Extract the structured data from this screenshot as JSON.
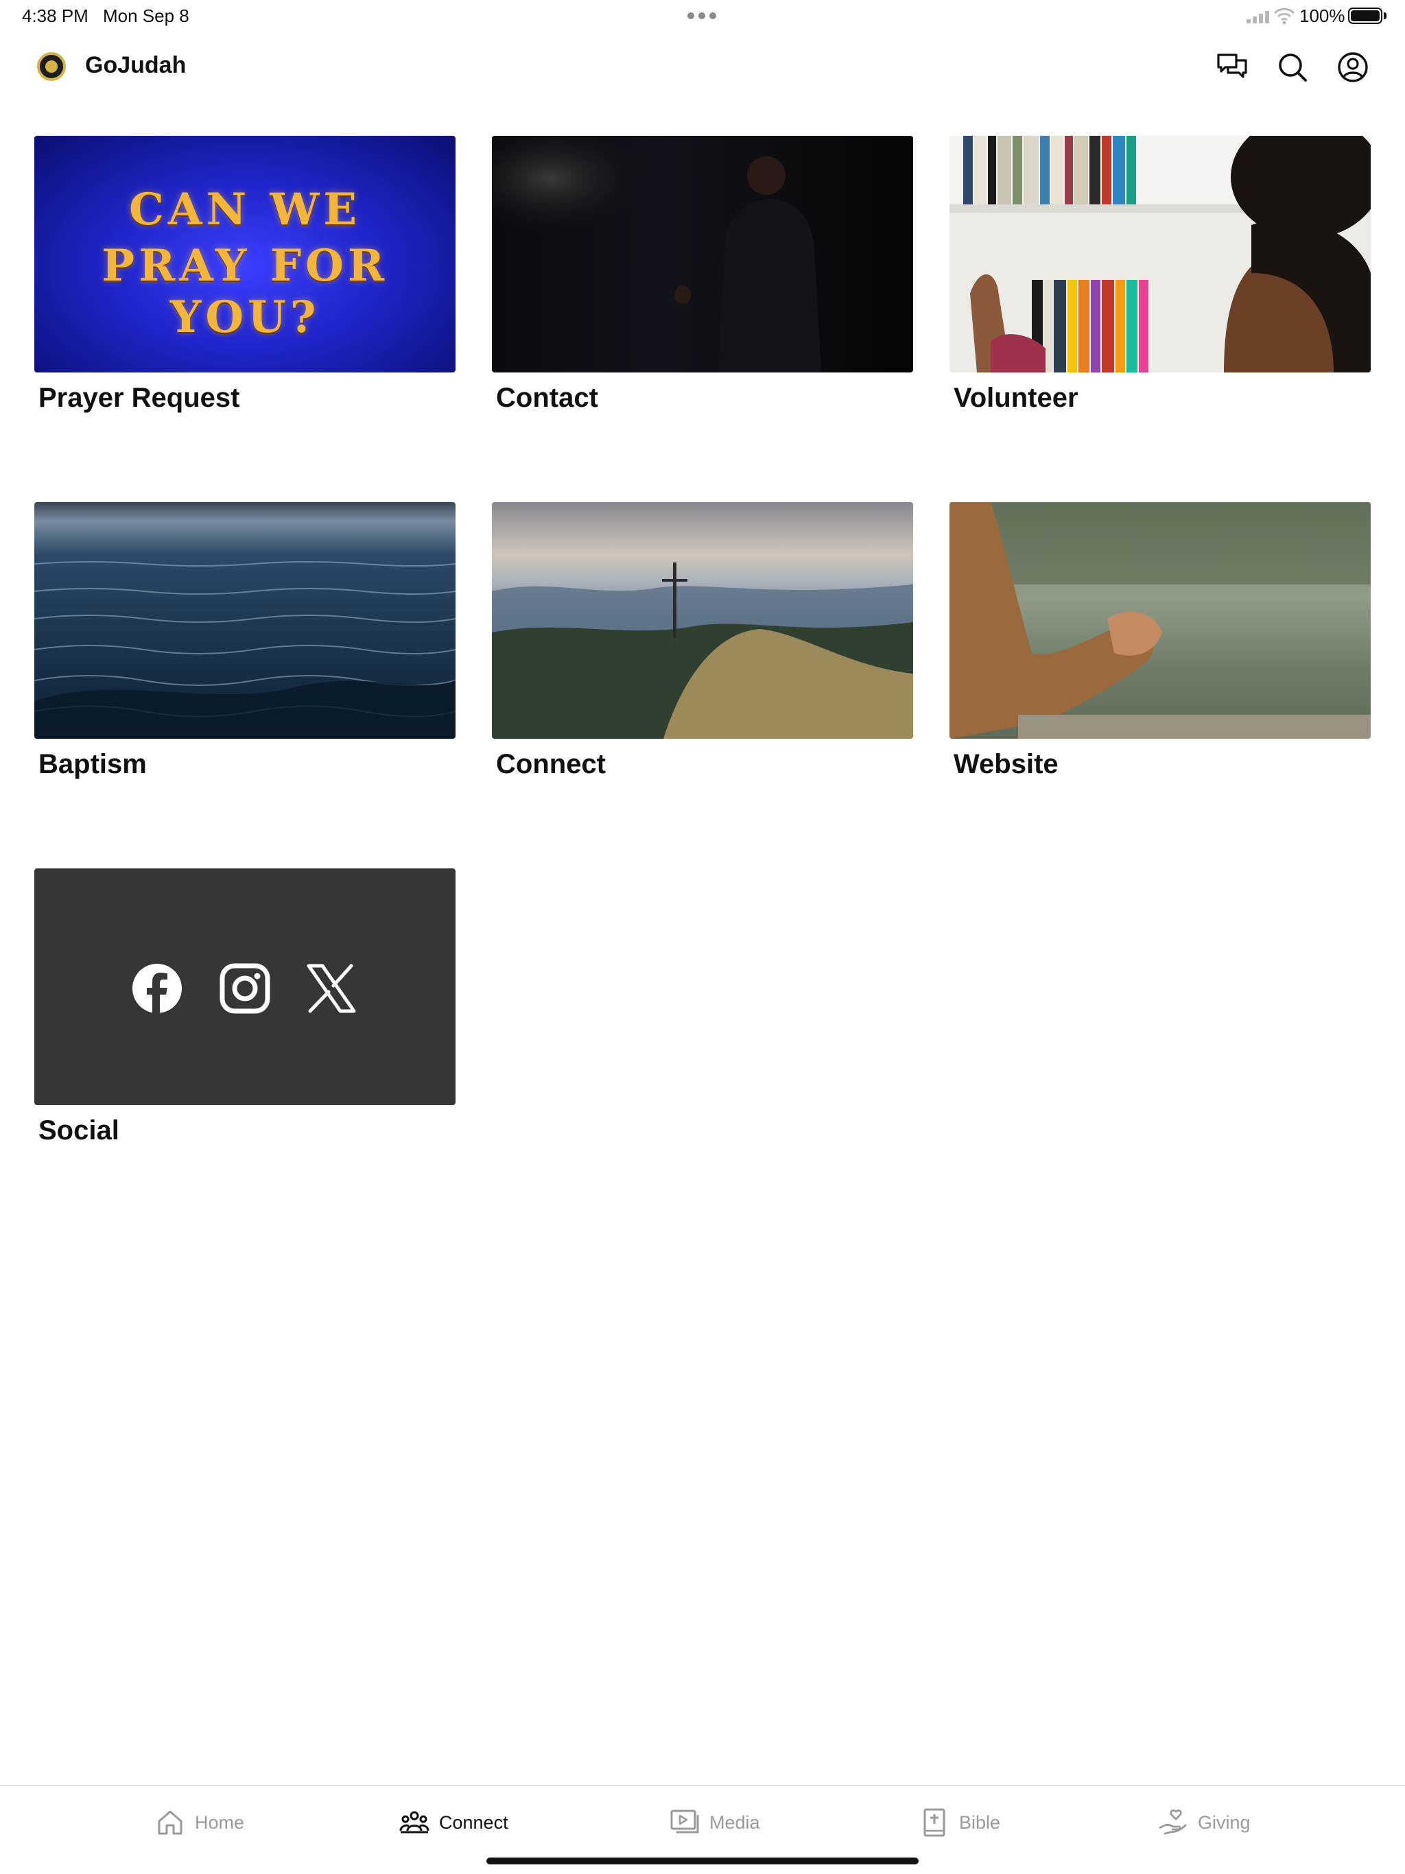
{
  "status_bar": {
    "time": "4:38 PM",
    "date": "Mon Sep 8",
    "battery": "100%"
  },
  "header": {
    "title": "GoJudah",
    "icons": [
      "chat-icon",
      "search-icon",
      "profile-icon"
    ]
  },
  "cards": [
    {
      "label": "Prayer Request",
      "image_text": [
        "CAN WE",
        "PRAY FOR YOU?"
      ]
    },
    {
      "label": "Contact"
    },
    {
      "label": "Volunteer"
    },
    {
      "label": "Baptism"
    },
    {
      "label": "Connect"
    },
    {
      "label": "Website"
    },
    {
      "label": "Social",
      "icons": [
        "facebook-icon",
        "instagram-icon",
        "x-icon"
      ]
    }
  ],
  "tabs": [
    {
      "label": "Home",
      "icon": "home-icon",
      "active": false
    },
    {
      "label": "Connect",
      "icon": "people-icon",
      "active": true
    },
    {
      "label": "Media",
      "icon": "media-icon",
      "active": false
    },
    {
      "label": "Bible",
      "icon": "bible-icon",
      "active": false
    },
    {
      "label": "Giving",
      "icon": "giving-icon",
      "active": false
    }
  ],
  "colors": {
    "active_tab": "#111111",
    "inactive_tab": "#9a9a9a",
    "social_bg": "#363636"
  }
}
